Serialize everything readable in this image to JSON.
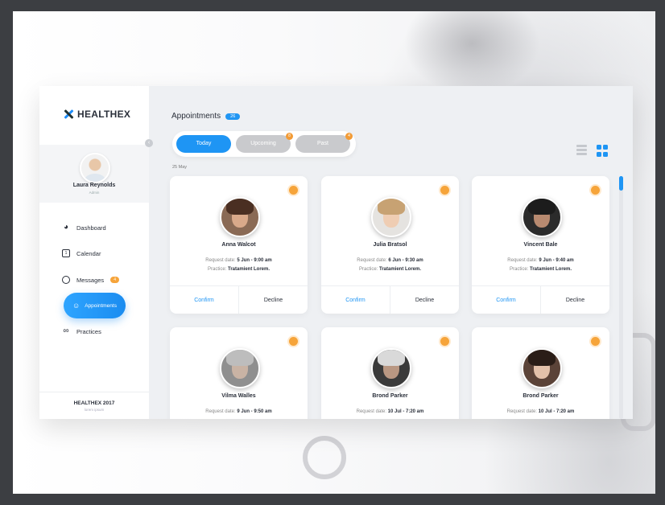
{
  "sidebar": {
    "brand": "HEALTHEX",
    "user": {
      "name": "Laura Reynolds",
      "role": "Admin"
    },
    "nav": [
      {
        "label": "Dashboard",
        "icon": "pie-chart-icon"
      },
      {
        "label": "Calendar",
        "icon": "calendar-icon"
      },
      {
        "label": "Messages",
        "icon": "chat-bubble-icon",
        "badge": "4"
      },
      {
        "label": "Appointments",
        "icon": "user-icon",
        "active": true
      },
      {
        "label": "Practices",
        "icon": "stethoscope-icon"
      }
    ],
    "footer": {
      "title": "HEALTHEX 2017",
      "subtitle": "lorem ipsum"
    }
  },
  "header": {
    "title": "Appointments",
    "count": "26"
  },
  "tabs": [
    {
      "label": "Today",
      "active": true
    },
    {
      "label": "Upcoming",
      "badge": "8"
    },
    {
      "label": "Past",
      "badge": "4"
    }
  ],
  "date_label": "25 May",
  "colors": {
    "accent": "#1e95f4",
    "badge": "#f6a43a"
  },
  "cards": [
    {
      "name": "Anna Walcot",
      "request_label": "Request date:",
      "request_date": "5 Jun - 9:00 am",
      "practice_label": "Practice:",
      "practice": "Tratamient Lorem.",
      "confirm": "Confirm",
      "decline": "Decline"
    },
    {
      "name": "Julia Bratsol",
      "request_label": "Request date:",
      "request_date": "6 Jun - 9:30 am",
      "practice_label": "Practice:",
      "practice": "Tratamient Lorem.",
      "confirm": "Confirm",
      "decline": "Decline"
    },
    {
      "name": "Vincent Bale",
      "request_label": "Request date:",
      "request_date": "9 Jun - 9:40 am",
      "practice_label": "Practice:",
      "practice": "Tratamient Lorem.",
      "confirm": "Confirm",
      "decline": "Decline"
    },
    {
      "name": "Vilma Walles",
      "request_label": "Request date:",
      "request_date": "9 Jun - 9:50 am"
    },
    {
      "name": "Brond Parker",
      "request_label": "Request date:",
      "request_date": "10 Jul - 7:20 am"
    },
    {
      "name": "Brond Parker",
      "request_label": "Request date:",
      "request_date": "10 Jul - 7:20 am"
    }
  ]
}
